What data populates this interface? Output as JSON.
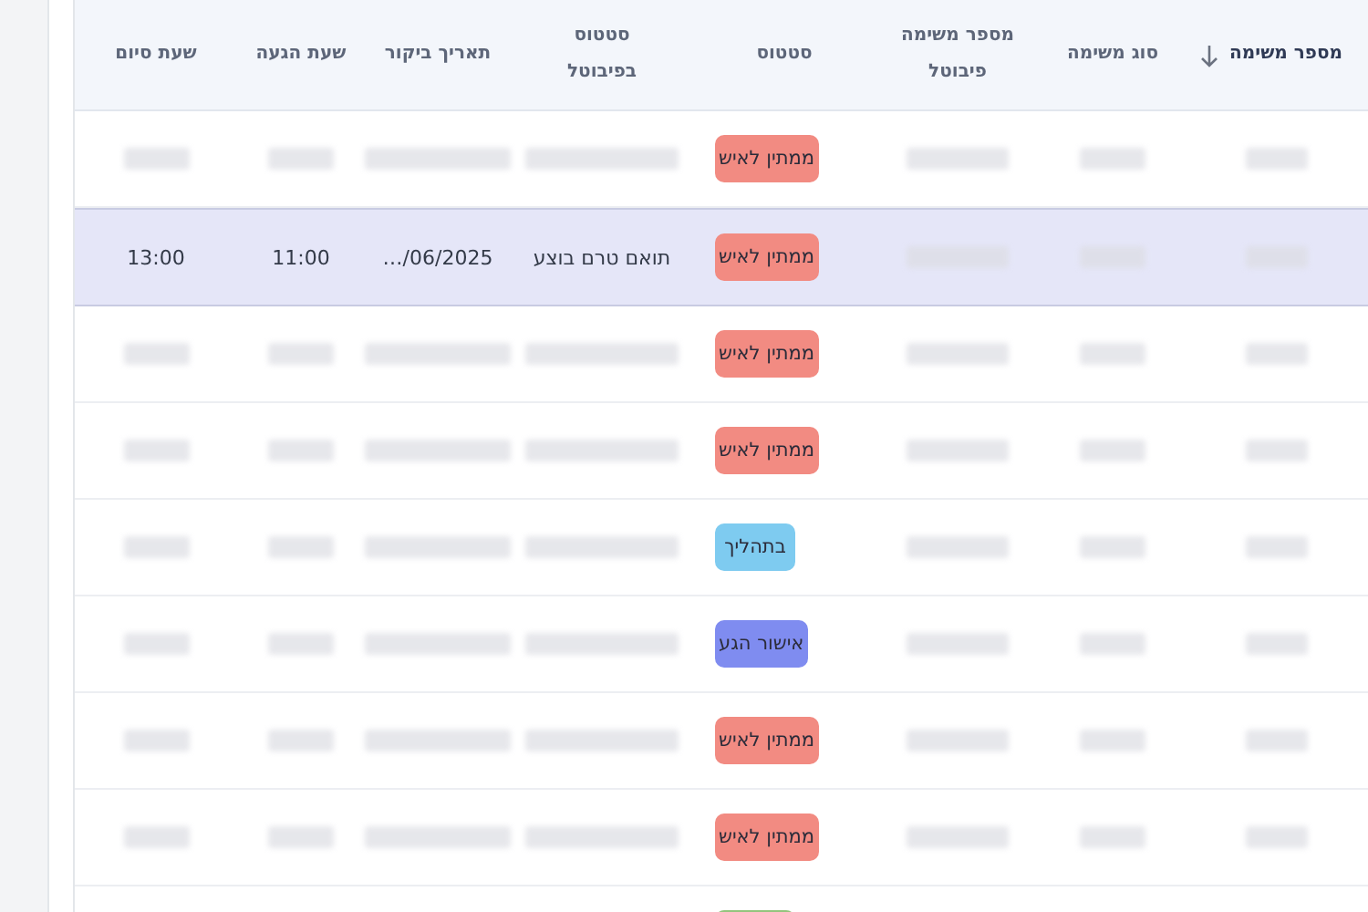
{
  "table": {
    "columns": [
      {
        "label": "מספר משימה",
        "sorted": true
      },
      {
        "label": "סוג משימה",
        "sorted": false
      },
      {
        "label": "מספר משימה פיבוטל",
        "sorted": false
      },
      {
        "label": "סטטוס",
        "sorted": false
      },
      {
        "label": "סטטוס בפיבוטל",
        "sorted": false
      },
      {
        "label": "תאריך ביקור",
        "sorted": false
      },
      {
        "label": "שעת הגעה",
        "sorted": false
      },
      {
        "label": "שעת סיום",
        "sorted": false
      }
    ],
    "rows": [
      {
        "selected": false,
        "cells": [
          {
            "kind": "redacted"
          },
          {
            "kind": "redacted"
          },
          {
            "kind": "redacted"
          },
          {
            "kind": "status",
            "text": "ממתין לאיש",
            "color": "#f28b82"
          },
          {
            "kind": "redacted"
          },
          {
            "kind": "redacted"
          },
          {
            "kind": "redacted"
          },
          {
            "kind": "redacted"
          }
        ]
      },
      {
        "selected": true,
        "cells": [
          {
            "kind": "redacted"
          },
          {
            "kind": "redacted"
          },
          {
            "kind": "redacted"
          },
          {
            "kind": "status",
            "text": "ממתין לאיש",
            "color": "#f28b82"
          },
          {
            "kind": "text",
            "text": "תואם טרם בוצע"
          },
          {
            "kind": "text",
            "text": "…/06/2025"
          },
          {
            "kind": "text",
            "text": "11:00"
          },
          {
            "kind": "text",
            "text": "13:00"
          }
        ]
      },
      {
        "selected": false,
        "cells": [
          {
            "kind": "redacted"
          },
          {
            "kind": "redacted"
          },
          {
            "kind": "redacted"
          },
          {
            "kind": "status",
            "text": "ממתין לאיש",
            "color": "#f28b82"
          },
          {
            "kind": "redacted"
          },
          {
            "kind": "redacted"
          },
          {
            "kind": "redacted"
          },
          {
            "kind": "redacted"
          }
        ]
      },
      {
        "selected": false,
        "cells": [
          {
            "kind": "redacted"
          },
          {
            "kind": "redacted"
          },
          {
            "kind": "redacted"
          },
          {
            "kind": "status",
            "text": "ממתין לאיש",
            "color": "#f28b82"
          },
          {
            "kind": "redacted"
          },
          {
            "kind": "redacted"
          },
          {
            "kind": "redacted"
          },
          {
            "kind": "redacted"
          }
        ]
      },
      {
        "selected": false,
        "cells": [
          {
            "kind": "redacted"
          },
          {
            "kind": "redacted"
          },
          {
            "kind": "redacted"
          },
          {
            "kind": "status",
            "text": "בתהליך",
            "color": "#7ecbf0"
          },
          {
            "kind": "redacted"
          },
          {
            "kind": "redacted"
          },
          {
            "kind": "redacted"
          },
          {
            "kind": "redacted"
          }
        ]
      },
      {
        "selected": false,
        "cells": [
          {
            "kind": "redacted"
          },
          {
            "kind": "redacted"
          },
          {
            "kind": "redacted"
          },
          {
            "kind": "status",
            "text": "אישור הגע",
            "color": "#7f8cf0"
          },
          {
            "kind": "redacted"
          },
          {
            "kind": "redacted"
          },
          {
            "kind": "redacted"
          },
          {
            "kind": "redacted"
          }
        ]
      },
      {
        "selected": false,
        "cells": [
          {
            "kind": "redacted"
          },
          {
            "kind": "redacted"
          },
          {
            "kind": "redacted"
          },
          {
            "kind": "status",
            "text": "ממתין לאיש",
            "color": "#f28b82"
          },
          {
            "kind": "redacted"
          },
          {
            "kind": "redacted"
          },
          {
            "kind": "redacted"
          },
          {
            "kind": "redacted"
          }
        ]
      },
      {
        "selected": false,
        "cells": [
          {
            "kind": "redacted"
          },
          {
            "kind": "redacted"
          },
          {
            "kind": "redacted"
          },
          {
            "kind": "status",
            "text": "ממתין לאיש",
            "color": "#f28b82"
          },
          {
            "kind": "redacted"
          },
          {
            "kind": "redacted"
          },
          {
            "kind": "redacted"
          },
          {
            "kind": "redacted"
          }
        ]
      },
      {
        "selected": false,
        "cells": [
          {
            "kind": "blank"
          },
          {
            "kind": "blank"
          },
          {
            "kind": "blank"
          },
          {
            "kind": "status",
            "color": "#93c47d"
          }
        ]
      }
    ]
  }
}
